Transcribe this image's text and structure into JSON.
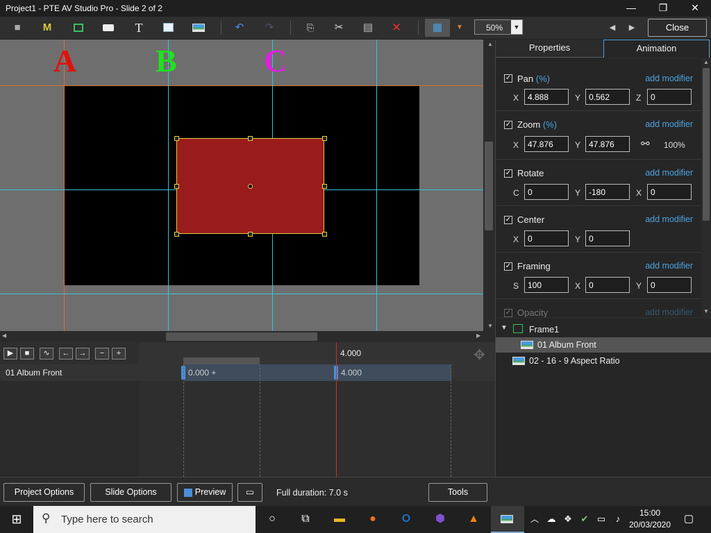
{
  "window": {
    "title": "Project1 - PTE AV Studio Pro - Slide 2 of 2",
    "minimize": "—",
    "maximize": "❐",
    "close": "✕"
  },
  "toolbar": {
    "zoom_value": "50%",
    "close_label": "Close",
    "icons": [
      "camera-icon",
      "mask-icon",
      "frame-icon",
      "button-icon",
      "text-icon",
      "rectangle-icon",
      "image-icon",
      "undo-icon",
      "redo-icon",
      "copy-icon",
      "cut-icon",
      "paste-icon",
      "delete-icon",
      "grid-icon",
      "dropdown-arrow-icon",
      "prev-slide-icon",
      "next-slide-icon"
    ]
  },
  "canvas": {
    "letters": [
      {
        "text": "A",
        "color": "#e01010"
      },
      {
        "text": "B",
        "color": "#20e020"
      },
      {
        "text": "C",
        "color": "#e020e0"
      }
    ]
  },
  "panel": {
    "tabs": [
      {
        "label": "Properties"
      },
      {
        "label": "Animation"
      }
    ],
    "sections": [
      {
        "label": "Pan",
        "unit": "(%)",
        "add": "add modifier",
        "fields": [
          {
            "l": "X",
            "v": "4.888"
          },
          {
            "l": "Y",
            "v": "0.562"
          },
          {
            "l": "Z",
            "v": "0"
          }
        ]
      },
      {
        "label": "Zoom",
        "unit": "(%)",
        "add": "add modifier",
        "fields": [
          {
            "l": "X",
            "v": "47.876"
          },
          {
            "l": "Y",
            "v": "47.876"
          }
        ],
        "link_value": "100%"
      },
      {
        "label": "Rotate",
        "unit": "",
        "add": "add modifier",
        "fields": [
          {
            "l": "C",
            "v": "0"
          },
          {
            "l": "Y",
            "v": "-180"
          },
          {
            "l": "X",
            "v": "0"
          }
        ]
      },
      {
        "label": "Center",
        "unit": "",
        "add": "add modifier",
        "fields": [
          {
            "l": "X",
            "v": "0"
          },
          {
            "l": "Y",
            "v": "0"
          }
        ]
      },
      {
        "label": "Framing",
        "unit": "",
        "add": "add modifier",
        "fields": [
          {
            "l": "S",
            "v": "100"
          },
          {
            "l": "X",
            "v": "0"
          },
          {
            "l": "Y",
            "v": "0"
          }
        ]
      },
      {
        "label": "Opacity",
        "unit": "",
        "add": "add modifier",
        "fields": []
      }
    ],
    "tree": [
      {
        "label": "Frame1",
        "level": 0,
        "type": "frame"
      },
      {
        "label": "01 Album Front",
        "level": 1,
        "type": "image",
        "selected": true
      },
      {
        "label": "02 - 16 - 9 Aspect Ratio",
        "level": 0,
        "type": "image"
      }
    ]
  },
  "timeline": {
    "track_name": "01 Album Front",
    "ruler_label": "4.000",
    "keyframes": [
      {
        "label": "0.000 +"
      },
      {
        "label": "4.000"
      }
    ]
  },
  "bottom": {
    "project_options": "Project Options",
    "slide_options": "Slide Options",
    "preview": "Preview",
    "full_duration": "Full duration: 7.0 s",
    "tools": "Tools"
  },
  "taskbar": {
    "search_placeholder": "Type here to search",
    "time": "15:00",
    "date": "20/03/2020"
  }
}
